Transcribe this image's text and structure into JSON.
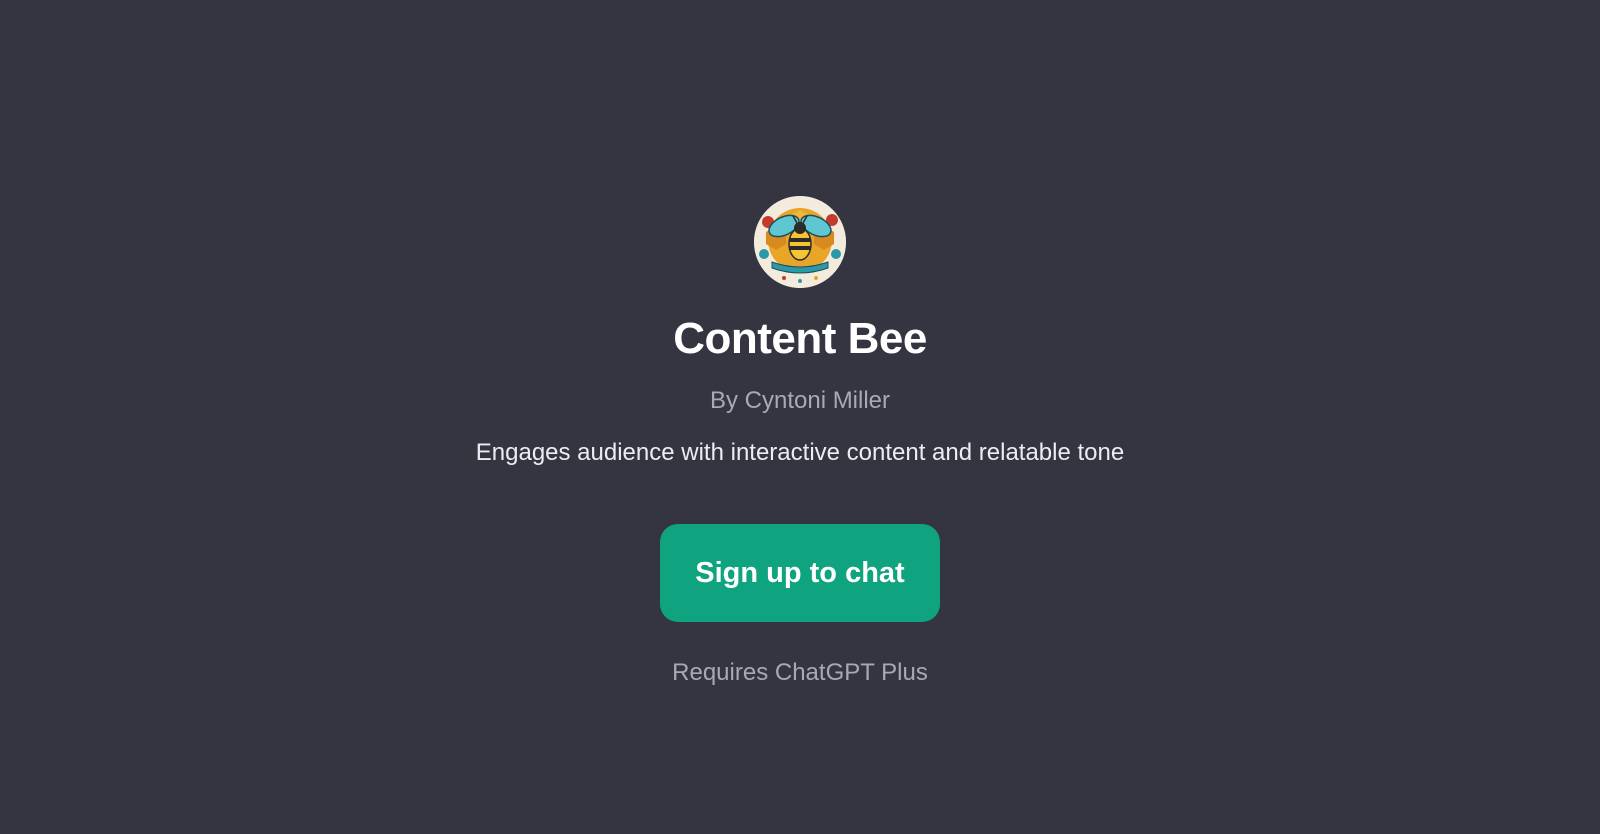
{
  "gpt": {
    "name": "Content Bee",
    "author": "By Cyntoni Miller",
    "description": "Engages audience with interactive content and relatable tone",
    "avatar_icon": "bee-illustration-logo"
  },
  "cta": {
    "label": "Sign up to chat"
  },
  "note": "Requires ChatGPT Plus",
  "colors": {
    "background": "#343541",
    "accent": "#10a37f",
    "title": "#ffffff",
    "muted": "#a9a9b3",
    "body_text": "#ececf1"
  }
}
